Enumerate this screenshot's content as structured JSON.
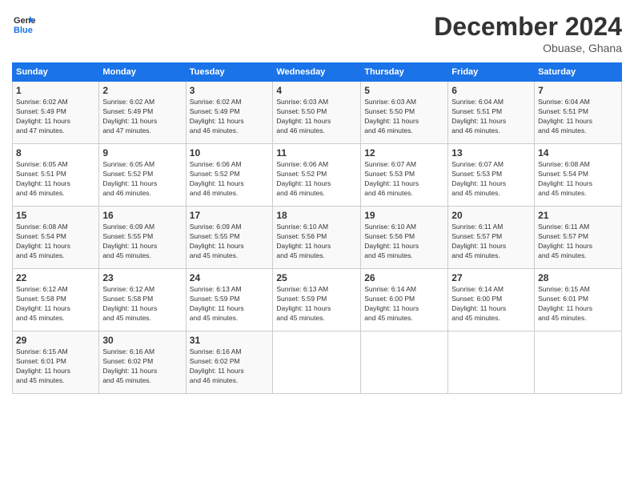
{
  "logo": {
    "line1": "General",
    "line2": "Blue"
  },
  "title": "December 2024",
  "location": "Obuase, Ghana",
  "days_header": [
    "Sunday",
    "Monday",
    "Tuesday",
    "Wednesday",
    "Thursday",
    "Friday",
    "Saturday"
  ],
  "weeks": [
    [
      {
        "day": "1",
        "info": "Sunrise: 6:02 AM\nSunset: 5:49 PM\nDaylight: 11 hours\nand 47 minutes."
      },
      {
        "day": "2",
        "info": "Sunrise: 6:02 AM\nSunset: 5:49 PM\nDaylight: 11 hours\nand 47 minutes."
      },
      {
        "day": "3",
        "info": "Sunrise: 6:02 AM\nSunset: 5:49 PM\nDaylight: 11 hours\nand 46 minutes."
      },
      {
        "day": "4",
        "info": "Sunrise: 6:03 AM\nSunset: 5:50 PM\nDaylight: 11 hours\nand 46 minutes."
      },
      {
        "day": "5",
        "info": "Sunrise: 6:03 AM\nSunset: 5:50 PM\nDaylight: 11 hours\nand 46 minutes."
      },
      {
        "day": "6",
        "info": "Sunrise: 6:04 AM\nSunset: 5:51 PM\nDaylight: 11 hours\nand 46 minutes."
      },
      {
        "day": "7",
        "info": "Sunrise: 6:04 AM\nSunset: 5:51 PM\nDaylight: 11 hours\nand 46 minutes."
      }
    ],
    [
      {
        "day": "8",
        "info": "Sunrise: 6:05 AM\nSunset: 5:51 PM\nDaylight: 11 hours\nand 46 minutes."
      },
      {
        "day": "9",
        "info": "Sunrise: 6:05 AM\nSunset: 5:52 PM\nDaylight: 11 hours\nand 46 minutes."
      },
      {
        "day": "10",
        "info": "Sunrise: 6:06 AM\nSunset: 5:52 PM\nDaylight: 11 hours\nand 46 minutes."
      },
      {
        "day": "11",
        "info": "Sunrise: 6:06 AM\nSunset: 5:52 PM\nDaylight: 11 hours\nand 46 minutes."
      },
      {
        "day": "12",
        "info": "Sunrise: 6:07 AM\nSunset: 5:53 PM\nDaylight: 11 hours\nand 46 minutes."
      },
      {
        "day": "13",
        "info": "Sunrise: 6:07 AM\nSunset: 5:53 PM\nDaylight: 11 hours\nand 45 minutes."
      },
      {
        "day": "14",
        "info": "Sunrise: 6:08 AM\nSunset: 5:54 PM\nDaylight: 11 hours\nand 45 minutes."
      }
    ],
    [
      {
        "day": "15",
        "info": "Sunrise: 6:08 AM\nSunset: 5:54 PM\nDaylight: 11 hours\nand 45 minutes."
      },
      {
        "day": "16",
        "info": "Sunrise: 6:09 AM\nSunset: 5:55 PM\nDaylight: 11 hours\nand 45 minutes."
      },
      {
        "day": "17",
        "info": "Sunrise: 6:09 AM\nSunset: 5:55 PM\nDaylight: 11 hours\nand 45 minutes."
      },
      {
        "day": "18",
        "info": "Sunrise: 6:10 AM\nSunset: 5:56 PM\nDaylight: 11 hours\nand 45 minutes."
      },
      {
        "day": "19",
        "info": "Sunrise: 6:10 AM\nSunset: 5:56 PM\nDaylight: 11 hours\nand 45 minutes."
      },
      {
        "day": "20",
        "info": "Sunrise: 6:11 AM\nSunset: 5:57 PM\nDaylight: 11 hours\nand 45 minutes."
      },
      {
        "day": "21",
        "info": "Sunrise: 6:11 AM\nSunset: 5:57 PM\nDaylight: 11 hours\nand 45 minutes."
      }
    ],
    [
      {
        "day": "22",
        "info": "Sunrise: 6:12 AM\nSunset: 5:58 PM\nDaylight: 11 hours\nand 45 minutes."
      },
      {
        "day": "23",
        "info": "Sunrise: 6:12 AM\nSunset: 5:58 PM\nDaylight: 11 hours\nand 45 minutes."
      },
      {
        "day": "24",
        "info": "Sunrise: 6:13 AM\nSunset: 5:59 PM\nDaylight: 11 hours\nand 45 minutes."
      },
      {
        "day": "25",
        "info": "Sunrise: 6:13 AM\nSunset: 5:59 PM\nDaylight: 11 hours\nand 45 minutes."
      },
      {
        "day": "26",
        "info": "Sunrise: 6:14 AM\nSunset: 6:00 PM\nDaylight: 11 hours\nand 45 minutes."
      },
      {
        "day": "27",
        "info": "Sunrise: 6:14 AM\nSunset: 6:00 PM\nDaylight: 11 hours\nand 45 minutes."
      },
      {
        "day": "28",
        "info": "Sunrise: 6:15 AM\nSunset: 6:01 PM\nDaylight: 11 hours\nand 45 minutes."
      }
    ],
    [
      {
        "day": "29",
        "info": "Sunrise: 6:15 AM\nSunset: 6:01 PM\nDaylight: 11 hours\nand 45 minutes."
      },
      {
        "day": "30",
        "info": "Sunrise: 6:16 AM\nSunset: 6:02 PM\nDaylight: 11 hours\nand 45 minutes."
      },
      {
        "day": "31",
        "info": "Sunrise: 6:16 AM\nSunset: 6:02 PM\nDaylight: 11 hours\nand 46 minutes."
      },
      {
        "day": "",
        "info": ""
      },
      {
        "day": "",
        "info": ""
      },
      {
        "day": "",
        "info": ""
      },
      {
        "day": "",
        "info": ""
      }
    ]
  ]
}
